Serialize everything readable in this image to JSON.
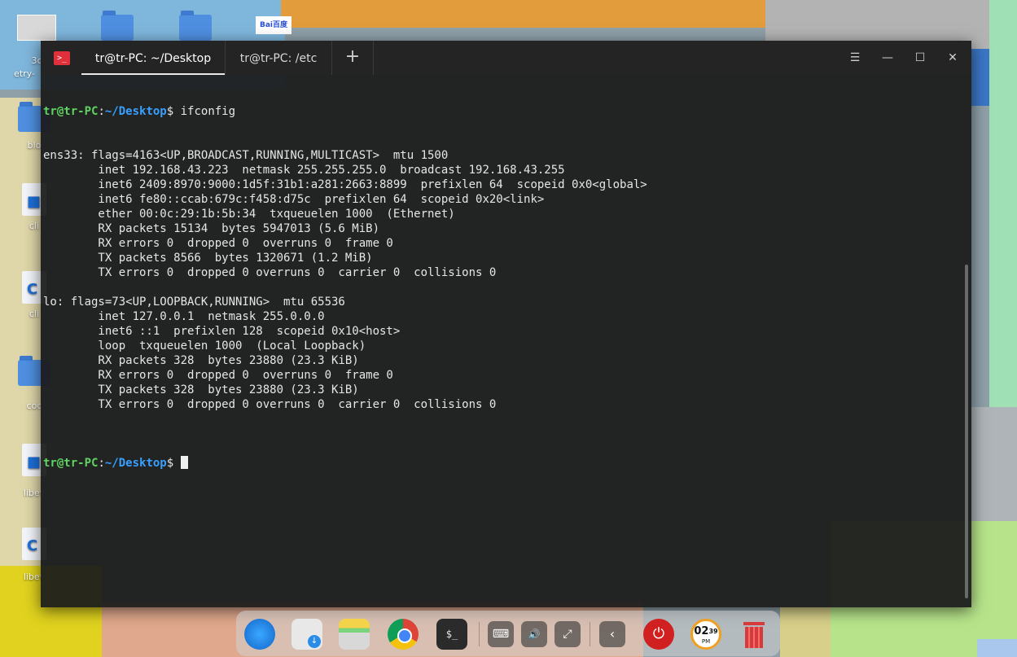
{
  "desktop": {
    "icons": [
      {
        "label": "3c"
      },
      {
        "label": "etry-"
      },
      {
        "label": "blo"
      },
      {
        "label": "cli"
      },
      {
        "label": "cli"
      },
      {
        "label": "coc"
      },
      {
        "label": "libev"
      },
      {
        "label": "libev"
      },
      {
        "label": "Bai百度"
      }
    ]
  },
  "terminal": {
    "app_icon": ">_",
    "tabs": [
      {
        "label": "tr@tr-PC: ~/Desktop",
        "active": true
      },
      {
        "label": "tr@tr-PC: /etc",
        "active": false
      }
    ],
    "new_tab_label": "+",
    "window_buttons": {
      "menu": "☰",
      "minimize": "—",
      "maximize": "☐",
      "close": "✕"
    },
    "prompt": {
      "user": "tr@tr-PC",
      "sep": ":",
      "path": "~/Desktop",
      "sym": "$"
    },
    "command": " ifconfig",
    "output": [
      "ens33: flags=4163<UP,BROADCAST,RUNNING,MULTICAST>  mtu 1500",
      "        inet 192.168.43.223  netmask 255.255.255.0  broadcast 192.168.43.255",
      "        inet6 2409:8970:9000:1d5f:31b1:a281:2663:8899  prefixlen 64  scopeid 0x0<global>",
      "        inet6 fe80::ccab:679c:f458:d75c  prefixlen 64  scopeid 0x20<link>",
      "        ether 00:0c:29:1b:5b:34  txqueuelen 1000  (Ethernet)",
      "        RX packets 15134  bytes 5947013 (5.6 MiB)",
      "        RX errors 0  dropped 0  overruns 0  frame 0",
      "        TX packets 8566  bytes 1320671 (1.2 MiB)",
      "        TX errors 0  dropped 0 overruns 0  carrier 0  collisions 0",
      "",
      "lo: flags=73<UP,LOOPBACK,RUNNING>  mtu 65536",
      "        inet 127.0.0.1  netmask 255.0.0.0",
      "        inet6 ::1  prefixlen 128  scopeid 0x10<host>",
      "        loop  txqueuelen 1000  (Local Loopback)",
      "        RX packets 328  bytes 23880 (23.3 KiB)",
      "        RX errors 0  dropped 0  overruns 0  frame 0",
      "        TX packets 328  bytes 23880 (23.3 KiB)",
      "        TX errors 0  dropped 0 overruns 0  carrier 0  collisions 0",
      ""
    ]
  },
  "dock": {
    "items": [
      {
        "name": "launcher-icon"
      },
      {
        "name": "app-store-icon"
      },
      {
        "name": "file-manager-icon"
      },
      {
        "name": "chrome-icon"
      },
      {
        "name": "terminal-icon",
        "glyph": "$_"
      },
      {
        "name": "keyboard-icon",
        "glyph": "⌨"
      },
      {
        "name": "volume-icon",
        "glyph": "🔊"
      },
      {
        "name": "network-icon",
        "glyph": "⤢"
      },
      {
        "name": "collapse-icon",
        "glyph": "‹"
      },
      {
        "name": "power-icon",
        "glyph": "⏻"
      },
      {
        "name": "clock-icon"
      },
      {
        "name": "trash-icon"
      }
    ],
    "clock": {
      "hour": "02",
      "minute": "39",
      "ampm": "PM"
    }
  },
  "colors": {
    "prompt_user": "#5fd35f",
    "prompt_path": "#3aa0ff",
    "close_accent": "#e0303c"
  }
}
